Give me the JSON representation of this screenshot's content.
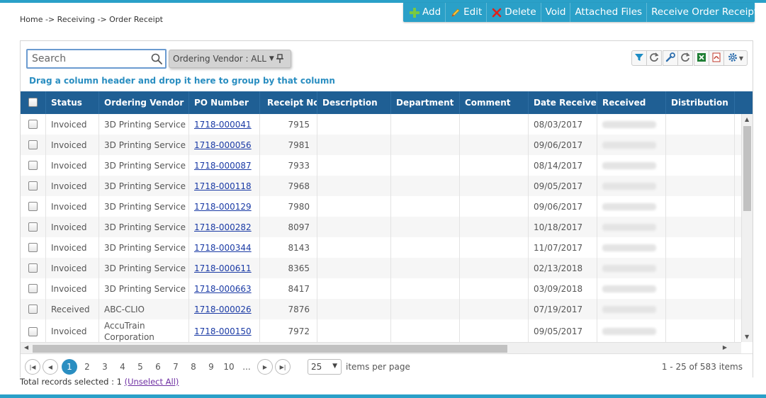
{
  "breadcrumb": "Home -> Receiving -> Order Receipt",
  "toolbar": {
    "add": "Add",
    "edit": "Edit",
    "delete": "Delete",
    "void": "Void",
    "attached_files": "Attached Files",
    "receive_order_receipt": "Receive Order Receipt"
  },
  "search": {
    "placeholder": "Search"
  },
  "filter_chip": "Ordering Vendor : ALL",
  "group_hint": "Drag a column header and drop it here to group by that column",
  "columns": {
    "status": "Status",
    "ordering_vendor": "Ordering Vendor",
    "po_number": "PO Number",
    "receipt_no": "Receipt No.",
    "description": "Description",
    "department": "Department",
    "comment": "Comment",
    "date_received": "Date Received",
    "received": "Received",
    "distribution": "Distribution"
  },
  "rows": [
    {
      "status": "Invoiced",
      "vendor": "3D Printing Service",
      "po": "1718-000041",
      "receipt": "7915",
      "date": "08/03/2017"
    },
    {
      "status": "Invoiced",
      "vendor": "3D Printing Service",
      "po": "1718-000056",
      "receipt": "7981",
      "date": "09/06/2017"
    },
    {
      "status": "Invoiced",
      "vendor": "3D Printing Service",
      "po": "1718-000087",
      "receipt": "7933",
      "date": "08/14/2017"
    },
    {
      "status": "Invoiced",
      "vendor": "3D Printing Service",
      "po": "1718-000118",
      "receipt": "7968",
      "date": "09/05/2017"
    },
    {
      "status": "Invoiced",
      "vendor": "3D Printing Service",
      "po": "1718-000129",
      "receipt": "7980",
      "date": "09/06/2017"
    },
    {
      "status": "Invoiced",
      "vendor": "3D Printing Service",
      "po": "1718-000282",
      "receipt": "8097",
      "date": "10/18/2017"
    },
    {
      "status": "Invoiced",
      "vendor": "3D Printing Service",
      "po": "1718-000344",
      "receipt": "8143",
      "date": "11/07/2017"
    },
    {
      "status": "Invoiced",
      "vendor": "3D Printing Service",
      "po": "1718-000611",
      "receipt": "8365",
      "date": "02/13/2018"
    },
    {
      "status": "Invoiced",
      "vendor": "3D Printing Service",
      "po": "1718-000663",
      "receipt": "8417",
      "date": "03/09/2018"
    },
    {
      "status": "Received",
      "vendor": "ABC-CLIO",
      "po": "1718-000026",
      "receipt": "7876",
      "date": "07/19/2017"
    },
    {
      "status": "Invoiced",
      "vendor": "AccuTrain Corporation",
      "po": "1718-000150",
      "receipt": "7972",
      "date": "09/05/2017"
    }
  ],
  "pager": {
    "pages": [
      "1",
      "2",
      "3",
      "4",
      "5",
      "6",
      "7",
      "8",
      "9",
      "10",
      "..."
    ],
    "current_page": "1",
    "page_size": "25",
    "items_per_page_label": "items per page",
    "range": "1 - 25 of 583 items"
  },
  "footer": {
    "selected_text": "Total records selected : 1",
    "unselect_link": "(Unselect All)"
  },
  "colors": {
    "accent": "#2aa0c8",
    "header_bg": "#1f5f94",
    "link": "#1a3aa5",
    "hint_text": "#2a8ec1"
  },
  "icons": [
    "plus-icon",
    "pencil-icon",
    "x-icon",
    "search-icon",
    "pin-icon",
    "funnel-icon",
    "refresh-icon",
    "wrench-icon",
    "excel-icon",
    "pdf-icon",
    "gear-icon",
    "caret-down-icon",
    "sort-up-icon"
  ]
}
